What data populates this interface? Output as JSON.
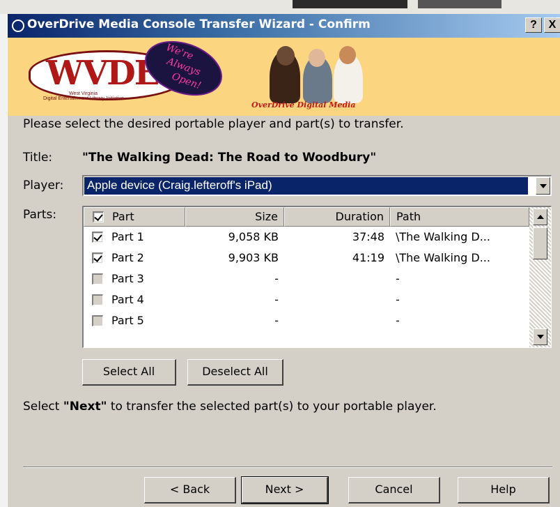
{
  "window": {
    "title": "OverDrive Media Console Transfer Wizard - Confirm",
    "help_button": "?",
    "close_button": "X"
  },
  "banner": {
    "logo_text": "WVDELI",
    "logo_subtitle1": "West Virginia",
    "logo_subtitle2": "Digital Entertainment Library Initiative",
    "sign_line1": "We're",
    "sign_line2": "Always",
    "sign_line3": "Open!",
    "brand_text": "OverDrive Digital Media",
    "brand_color": "#c21a1a",
    "background_color": "#fcd581"
  },
  "instruction": "Please select the desired portable player and part(s) to transfer.",
  "fields": {
    "title_label": "Title:",
    "title_value": "\"The Walking Dead: The Road to Woodbury\"",
    "player_label": "Player:",
    "player_value": "Apple device (Craig.lefteroff's iPad)",
    "parts_label": "Parts:"
  },
  "table": {
    "header_checked": true,
    "columns": [
      "Part",
      "Size",
      "Duration",
      "Path"
    ],
    "rows": [
      {
        "checked": true,
        "enabled": true,
        "part": "Part 1",
        "size": "9,058 KB",
        "duration": "37:48",
        "path": "\\The Walking D..."
      },
      {
        "checked": true,
        "enabled": true,
        "part": "Part 2",
        "size": "9,903 KB",
        "duration": "41:19",
        "path": "\\The Walking D..."
      },
      {
        "checked": false,
        "enabled": false,
        "part": "Part 3",
        "size": "-",
        "duration": "",
        "path": "-"
      },
      {
        "checked": false,
        "enabled": false,
        "part": "Part 4",
        "size": "-",
        "duration": "",
        "path": "-"
      },
      {
        "checked": false,
        "enabled": false,
        "part": "Part 5",
        "size": "-",
        "duration": "",
        "path": "-"
      }
    ]
  },
  "list_buttons": {
    "select_all": "Select All",
    "deselect_all": "Deselect All"
  },
  "hint": {
    "prefix": "Select ",
    "bold": "\"Next\"",
    "suffix": " to transfer the selected part(s) to your portable player."
  },
  "footer": {
    "back": "< Back",
    "next": "Next >",
    "cancel": "Cancel",
    "help": "Help"
  },
  "colors": {
    "selection": "#0a246a",
    "dialog_face": "#d4d0c8"
  }
}
